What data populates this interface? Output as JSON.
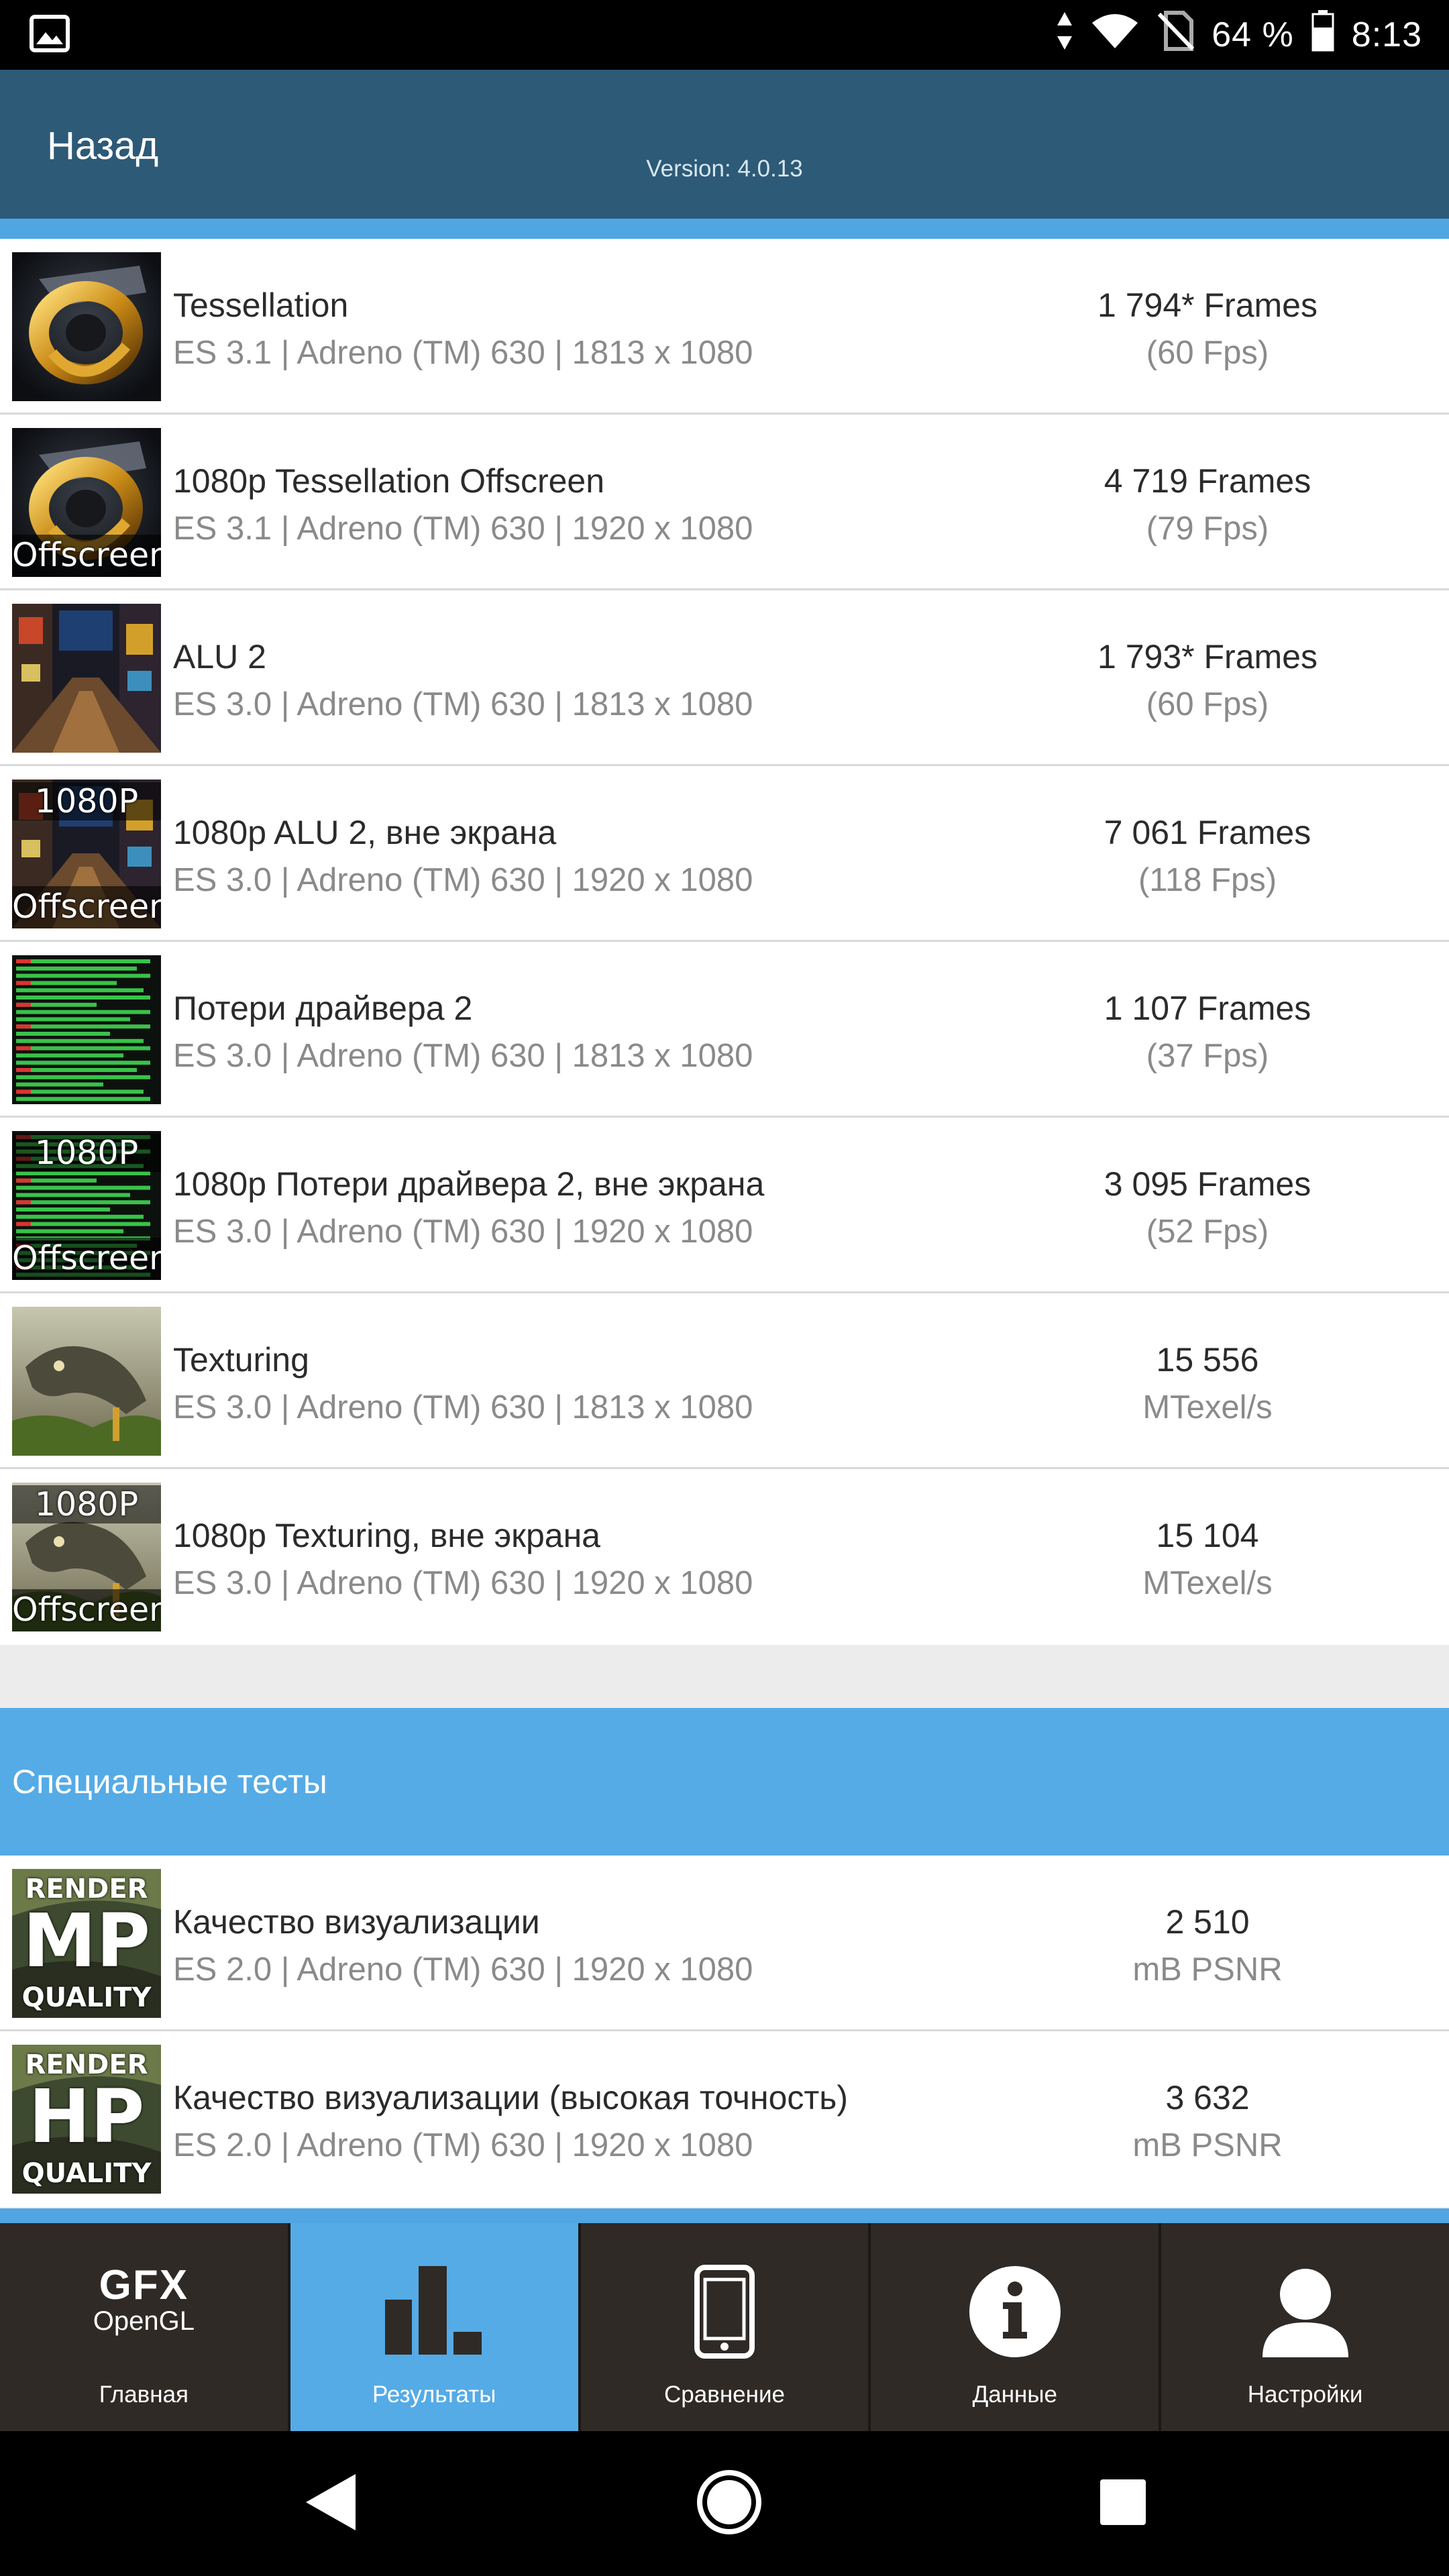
{
  "status_bar": {
    "gallery_icon": "image-icon",
    "battery_percent": "64 %",
    "time": "8:13"
  },
  "app_bar": {
    "back_label": "Назад",
    "version": "Version: 4.0.13"
  },
  "results": [
    {
      "title": "Tessellation",
      "subtitle": "ES 3.1 | Adreno (TM) 630 | 1813 x 1080",
      "value": "1 794* Frames",
      "unit": "(60 Fps)",
      "thumb": "tessellation",
      "badge_top": "",
      "badge_bottom": ""
    },
    {
      "title": "1080p Tessellation Offscreen",
      "subtitle": "ES 3.1 | Adreno (TM) 630 | 1920 x 1080",
      "value": "4 719 Frames",
      "unit": "(79 Fps)",
      "thumb": "tessellation",
      "badge_top": "",
      "badge_bottom": "Offscreen"
    },
    {
      "title": "ALU 2",
      "subtitle": "ES 3.0 | Adreno (TM) 630 | 1813 x 1080",
      "value": "1 793* Frames",
      "unit": "(60 Fps)",
      "thumb": "alu",
      "badge_top": "",
      "badge_bottom": ""
    },
    {
      "title": "1080p ALU 2, вне экрана",
      "subtitle": "ES 3.0 | Adreno (TM) 630 | 1920 x 1080",
      "value": "7 061 Frames",
      "unit": "(118 Fps)",
      "thumb": "alu",
      "badge_top": "1080P",
      "badge_bottom": "Offscreen"
    },
    {
      "title": "Потери драйвера 2",
      "subtitle": "ES 3.0 | Adreno (TM) 630 | 1813 x 1080",
      "value": "1 107 Frames",
      "unit": "(37 Fps)",
      "thumb": "driver",
      "badge_top": "",
      "badge_bottom": ""
    },
    {
      "title": "1080p Потери драйвера 2, вне экрана",
      "subtitle": "ES 3.0 | Adreno (TM) 630 | 1920 x 1080",
      "value": "3 095 Frames",
      "unit": "(52 Fps)",
      "thumb": "driver",
      "badge_top": "1080P",
      "badge_bottom": "Offscreen"
    },
    {
      "title": "Texturing",
      "subtitle": "ES 3.0 | Adreno (TM) 630 | 1813 x 1080",
      "value": "15 556",
      "unit": "MTexel/s",
      "thumb": "texturing",
      "badge_top": "",
      "badge_bottom": ""
    },
    {
      "title": "1080p Texturing, вне экрана",
      "subtitle": "ES 3.0 | Adreno (TM) 630 | 1920 x 1080",
      "value": "15 104",
      "unit": "MTexel/s",
      "thumb": "texturing",
      "badge_top": "1080P",
      "badge_bottom": "Offscreen"
    }
  ],
  "special_section": {
    "title": "Специальные тесты"
  },
  "special_results": [
    {
      "title": "Качество визуализации",
      "subtitle": "ES 2.0 | Adreno (TM) 630 | 1920 x 1080",
      "value": "2 510",
      "unit": "mB PSNR",
      "thumb": "render",
      "badge_top": "RENDER",
      "badge_mid": "MP",
      "badge_bottom": "QUALITY"
    },
    {
      "title": "Качество визуализации (высокая точность)",
      "subtitle": "ES 2.0 | Adreno (TM) 630 | 1920 x 1080",
      "value": "3 632",
      "unit": "mB PSNR",
      "thumb": "render",
      "badge_top": "RENDER",
      "badge_mid": "HP",
      "badge_bottom": "QUALITY"
    }
  ],
  "bottom_nav": [
    {
      "label": "Главная",
      "icon": "gfx-opengl-logo",
      "logo_top": "GFX",
      "logo_bottom": "OpenGL",
      "active": false
    },
    {
      "label": "Результаты",
      "icon": "bar-chart-icon",
      "active": true
    },
    {
      "label": "Сравнение",
      "icon": "phone-icon",
      "active": false
    },
    {
      "label": "Данные",
      "icon": "info-icon",
      "active": false
    },
    {
      "label": "Настройки",
      "icon": "user-icon",
      "active": false
    }
  ],
  "system_nav": {
    "back": "back-triangle-icon",
    "home": "home-circle-icon",
    "recents": "recents-square-icon"
  },
  "colors": {
    "app_bar": "#2c5a77",
    "accent": "#55abe6",
    "nav_bg": "#2f2a26"
  }
}
